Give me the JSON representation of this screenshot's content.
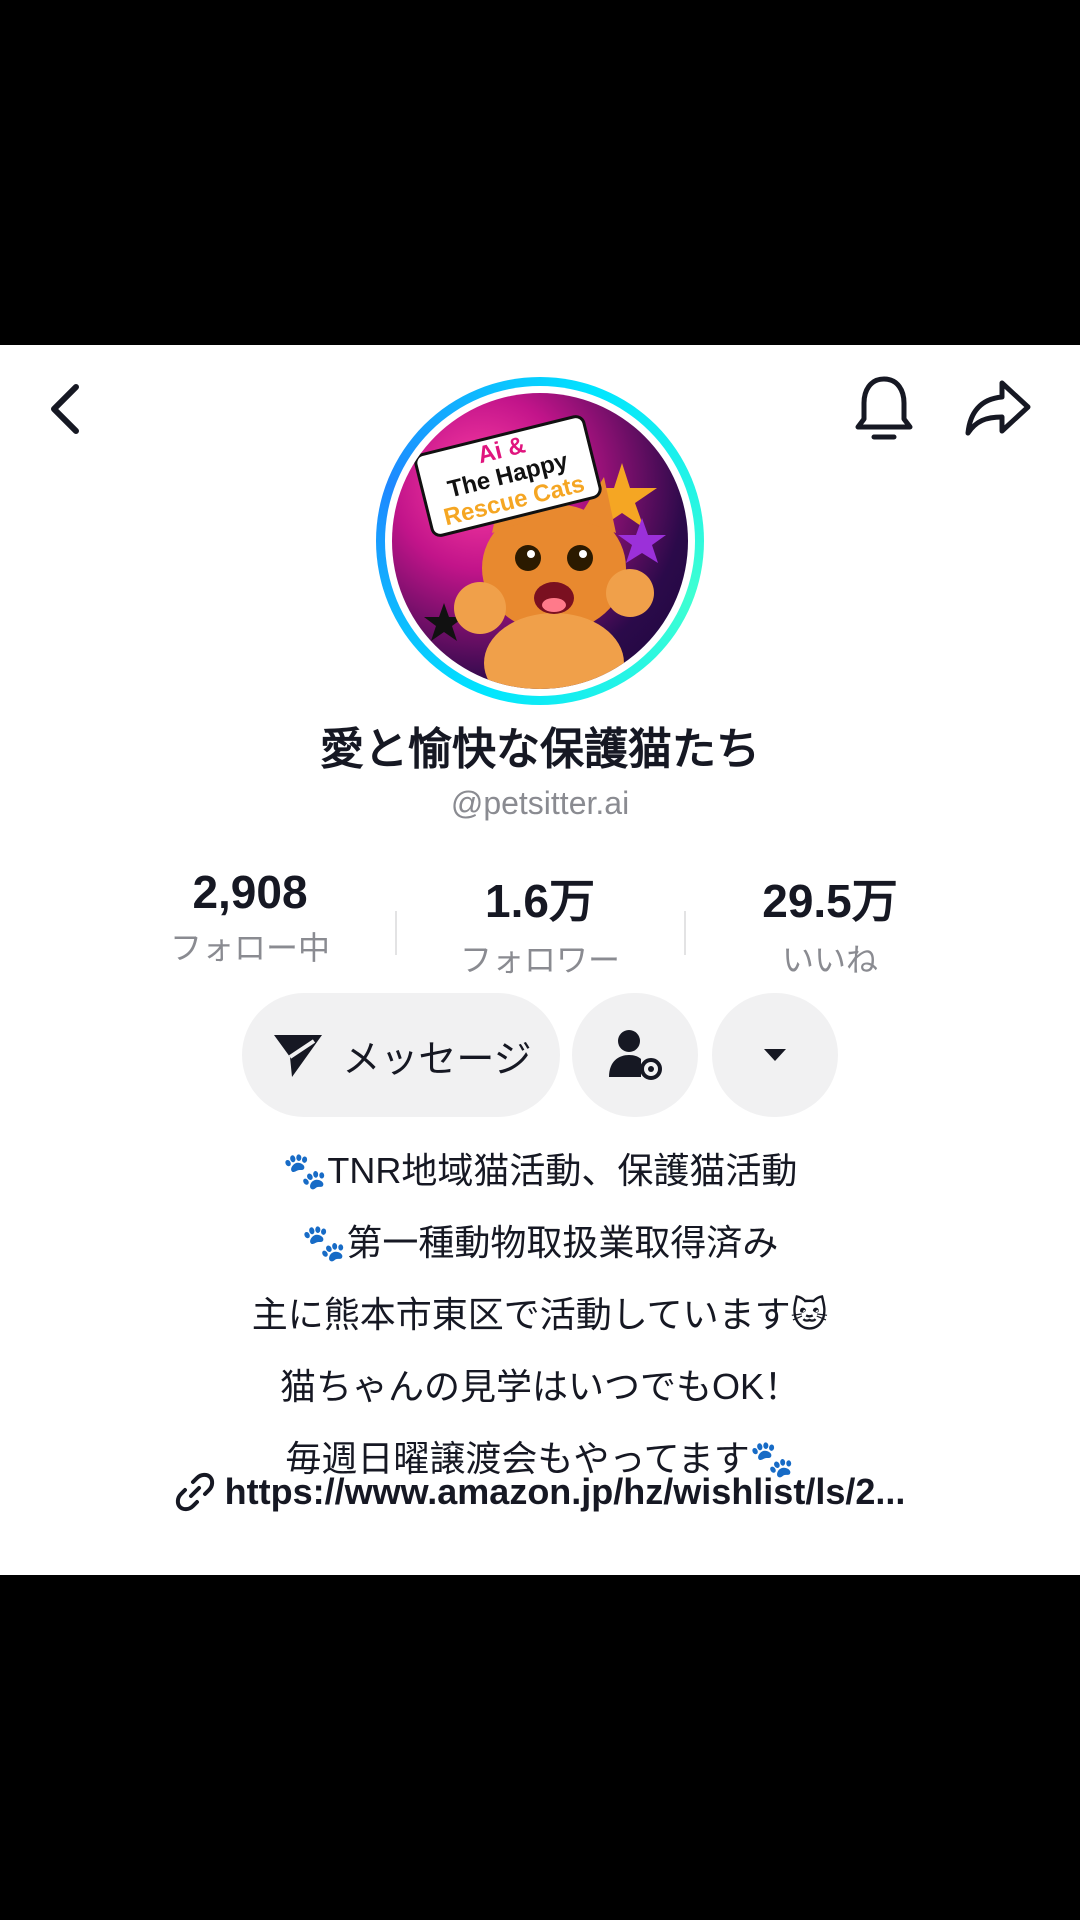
{
  "profile": {
    "display_name": "愛と愉快な保護猫たち",
    "handle": "@petsitter.ai",
    "avatar_text": [
      "Ai &",
      "The Happy",
      "Rescue Cats"
    ]
  },
  "stats": [
    {
      "value": "2,908",
      "label": "フォロー中"
    },
    {
      "value": "1.6万",
      "label": "フォロワー"
    },
    {
      "value": "29.5万",
      "label": "いいね"
    }
  ],
  "actions": {
    "message_label": "メッセージ"
  },
  "bio": [
    "🐾TNR地域猫活動、保護猫活動",
    "🐾第一種動物取扱業取得済み",
    "主に熊本市東区で活動しています🐱",
    "猫ちゃんの見学はいつでもOK！",
    "毎週日曜譲渡会もやってます🐾"
  ],
  "link": "https://www.amazon.jp/hz/wishlist/ls/2...",
  "icons": [
    "back-icon",
    "bell-icon",
    "share-icon",
    "send-icon",
    "user-settings-icon",
    "caret-down-icon",
    "link-icon"
  ],
  "colors": {
    "avatar_ring": "#00e5ff",
    "text_primary": "#161823",
    "text_secondary": "#8a8b91",
    "button_bg": "#f1f1f2"
  }
}
